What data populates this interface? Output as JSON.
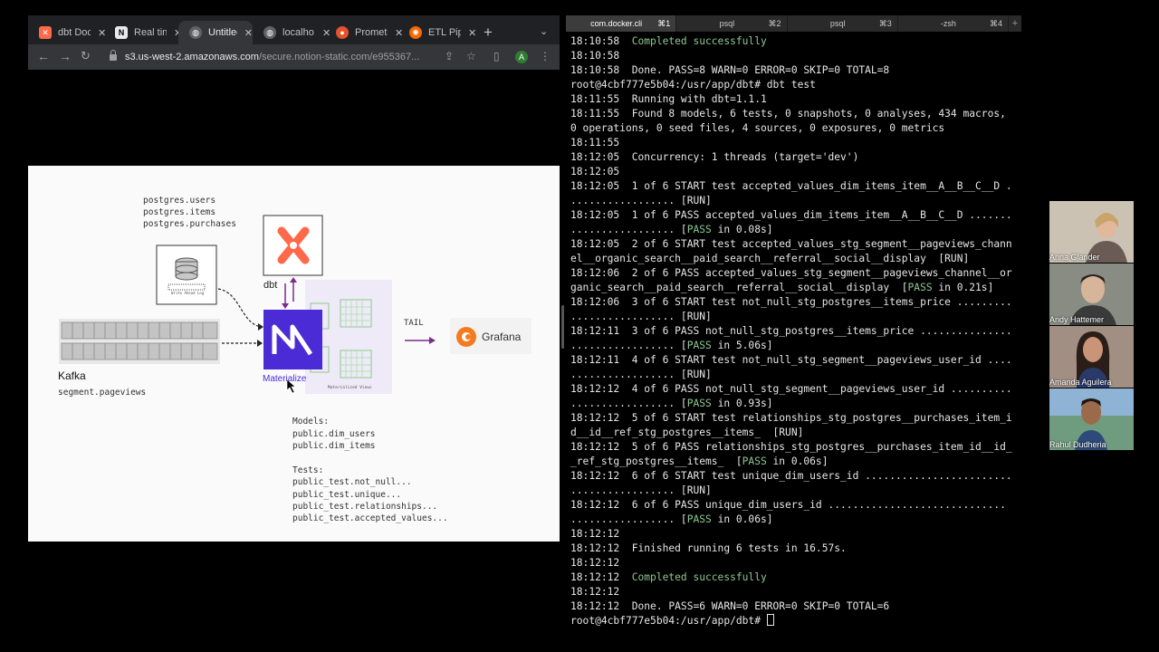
{
  "browser": {
    "tabs": [
      {
        "title": "dbt Doc",
        "icon": "dbt-icon",
        "color": "#ff694a"
      },
      {
        "title": "Real tin",
        "icon": "notion-icon",
        "color": "#e8eaed"
      },
      {
        "title": "Untitlec",
        "icon": "globe-icon",
        "color": "#9aa0a6"
      },
      {
        "title": "localho",
        "icon": "globe-icon",
        "color": "#9aa0a6"
      },
      {
        "title": "Promet",
        "icon": "prometheus-icon",
        "color": "#e6522c"
      },
      {
        "title": "ETL Pip",
        "icon": "grafana-icon",
        "color": "#f46800"
      }
    ],
    "url_host": "s3.us-west-2.amazonaws.com",
    "url_path": "/secure.notion-static.com/e955367...",
    "profile_initial": "A"
  },
  "whiteboard": {
    "postgres_tables": [
      "postgres.users",
      "postgres.items",
      "postgres.purchases"
    ],
    "wal_label": "Write Ahead Log",
    "dbt_label": "dbt",
    "materialize_label": "Materialize",
    "materialized_views_label": "Materialized Views",
    "tail_label": "TAIL",
    "grafana_label": "Grafana",
    "kafka_label": "Kafka",
    "kafka_topic": "segment.pageviews",
    "models_header": "Models:",
    "models": [
      "public.dim_users",
      "public.dim_items"
    ],
    "tests_header": "Tests:",
    "tests": [
      "public_test.not_null...",
      "public_test.unique...",
      "public_test.relationships...",
      "public_test.accepted_values..."
    ]
  },
  "terminal": {
    "tabs": [
      {
        "label": "com.docker.cli",
        "shortcut": "⌘1"
      },
      {
        "label": "psql",
        "shortcut": "⌘2"
      },
      {
        "label": "psql",
        "shortcut": "⌘3"
      },
      {
        "label": "-zsh",
        "shortcut": "⌘4"
      }
    ],
    "lines": [
      {
        "time": "18:10:58",
        "text": "Completed successfully",
        "green": true
      },
      {
        "time": "18:10:58",
        "text": ""
      },
      {
        "time": "18:10:58",
        "text": "Done. PASS=8 WARN=0 ERROR=0 SKIP=0 TOTAL=8"
      },
      {
        "time": "",
        "text": "root@4cbf777e5b04:/usr/app/dbt# dbt test"
      },
      {
        "time": "18:11:55",
        "text": "Running with dbt=1.1.1"
      },
      {
        "time": "18:11:55",
        "text": "Found 8 models, 6 tests, 0 snapshots, 0 analyses, 434 macros,"
      },
      {
        "time": "",
        "text": "0 operations, 0 seed files, 4 sources, 0 exposures, 0 metrics"
      },
      {
        "time": "18:11:55",
        "text": ""
      },
      {
        "time": "18:12:05",
        "text": "Concurrency: 1 threads (target='dev')"
      },
      {
        "time": "18:12:05",
        "text": ""
      },
      {
        "time": "18:12:05",
        "text": "1 of 6 START test accepted_values_dim_items_item__A__B__C__D ."
      },
      {
        "time": "",
        "text": "................. [RUN]"
      },
      {
        "time": "18:12:05",
        "text": "1 of 6 PASS accepted_values_dim_items_item__A__B__C__D ......."
      },
      {
        "time": "",
        "text": "................. [",
        "pass": "PASS",
        "after": " in 0.08s]"
      },
      {
        "time": "18:12:05",
        "text": "2 of 6 START test accepted_values_stg_segment__pageviews_chann"
      },
      {
        "time": "",
        "text": "el__organic_search__paid_search__referral__social__display  [RUN]"
      },
      {
        "time": "18:12:06",
        "text": "2 of 6 PASS accepted_values_stg_segment__pageviews_channel__or"
      },
      {
        "time": "",
        "text": "ganic_search__paid_search__referral__social__display  [",
        "pass": "PASS",
        "after": " in 0.21s]"
      },
      {
        "time": "18:12:06",
        "text": "3 of 6 START test not_null_stg_postgres__items_price ........."
      },
      {
        "time": "",
        "text": "................. [RUN]"
      },
      {
        "time": "18:12:11",
        "text": "3 of 6 PASS not_null_stg_postgres__items_price ..............."
      },
      {
        "time": "",
        "text": "................. [",
        "pass": "PASS",
        "after": " in 5.06s]"
      },
      {
        "time": "18:12:11",
        "text": "4 of 6 START test not_null_stg_segment__pageviews_user_id ...."
      },
      {
        "time": "",
        "text": "................. [RUN]"
      },
      {
        "time": "18:12:12",
        "text": "4 of 6 PASS not_null_stg_segment__pageviews_user_id .........."
      },
      {
        "time": "",
        "text": "................. [",
        "pass": "PASS",
        "after": " in 0.93s]"
      },
      {
        "time": "18:12:12",
        "text": "5 of 6 START test relationships_stg_postgres__purchases_item_i"
      },
      {
        "time": "",
        "text": "d__id__ref_stg_postgres__items_  [RUN]"
      },
      {
        "time": "18:12:12",
        "text": "5 of 6 PASS relationships_stg_postgres__purchases_item_id__id_"
      },
      {
        "time": "",
        "text": "_ref_stg_postgres__items_  [",
        "pass": "PASS",
        "after": " in 0.06s]"
      },
      {
        "time": "18:12:12",
        "text": "6 of 6 START test unique_dim_users_id ........................"
      },
      {
        "time": "",
        "text": "................. [RUN]"
      },
      {
        "time": "18:12:12",
        "text": "6 of 6 PASS unique_dim_users_id ............................."
      },
      {
        "time": "",
        "text": "................. [",
        "pass": "PASS",
        "after": " in 0.06s]"
      },
      {
        "time": "18:12:12",
        "text": ""
      },
      {
        "time": "18:12:12",
        "text": "Finished running 6 tests in 16.57s."
      },
      {
        "time": "18:12:12",
        "text": ""
      },
      {
        "time": "18:12:12",
        "text": "Completed successfully",
        "green": true
      },
      {
        "time": "18:12:12",
        "text": ""
      },
      {
        "time": "18:12:12",
        "text": "Done. PASS=6 WARN=0 ERROR=0 SKIP=0 TOTAL=6"
      },
      {
        "time": "",
        "text": "root@4cbf777e5b04:/usr/app/dbt# ",
        "cursor": true
      }
    ]
  },
  "participants": [
    {
      "name": "Anna Glander",
      "color": "#b8aa96"
    },
    {
      "name": "Andy Hattemer",
      "color": "#777a72"
    },
    {
      "name": "Amanda Aguilera",
      "color": "#8e7b70"
    },
    {
      "name": "Rahul Dudheria",
      "color": "#5a86b0"
    }
  ]
}
